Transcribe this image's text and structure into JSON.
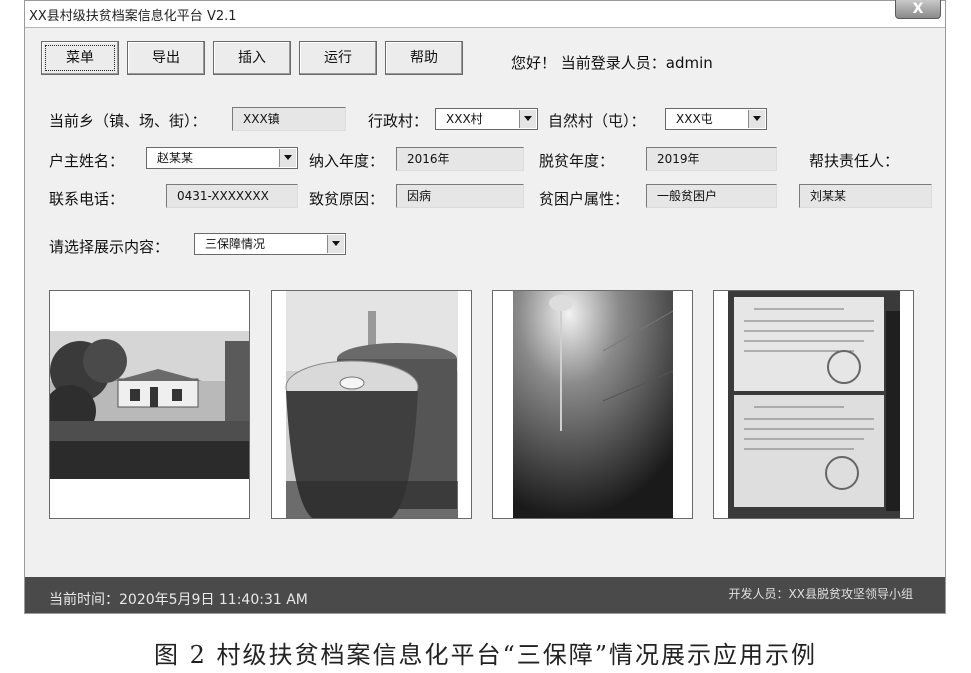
{
  "window": {
    "title": "XX县村级扶贫档案信息化平台 V2.1",
    "close_label": "X"
  },
  "toolbar": {
    "menu_label": "菜单",
    "export_label": "导出",
    "insert_label": "插入",
    "run_label": "运行",
    "help_label": "帮助"
  },
  "greeting": "您好！ 当前登录人员：admin",
  "form": {
    "township_label": "当前乡（镇、场、街）：",
    "township_value": "XXX镇",
    "admin_village_label": "行政村：",
    "admin_village_value": "XXX村",
    "natural_village_label": "自然村（屯）：",
    "natural_village_value": "XXX屯",
    "householder_label": "户主姓名：",
    "householder_value": "赵某某",
    "enroll_year_label": "纳入年度：",
    "enroll_year_value": "2016年",
    "exit_year_label": "脱贫年度：",
    "exit_year_value": "2019年",
    "responsible_label": "帮扶责任人：",
    "responsible_value": "刘某某",
    "phone_label": "联系电话：",
    "phone_value": "0431-XXXXXXX",
    "cause_label": "致贫原因：",
    "cause_value": "因病",
    "attribute_label": "贫困户属性：",
    "attribute_value": "一般贫困户",
    "display_label": "请选择展示内容：",
    "display_value": "三保障情况"
  },
  "photos": [
    {
      "icon": "house-photo-icon"
    },
    {
      "icon": "water-jar-photo-icon"
    },
    {
      "icon": "ceiling-lamp-photo-icon"
    },
    {
      "icon": "document-photo-icon"
    }
  ],
  "status": {
    "time": "当前时间：2020年5月9日  11:40:31 AM",
    "developer": "开发人员：XX县脱贫攻坚领导小组"
  },
  "caption": "图 2  村级扶贫档案信息化平台“三保障”情况展示应用示例"
}
